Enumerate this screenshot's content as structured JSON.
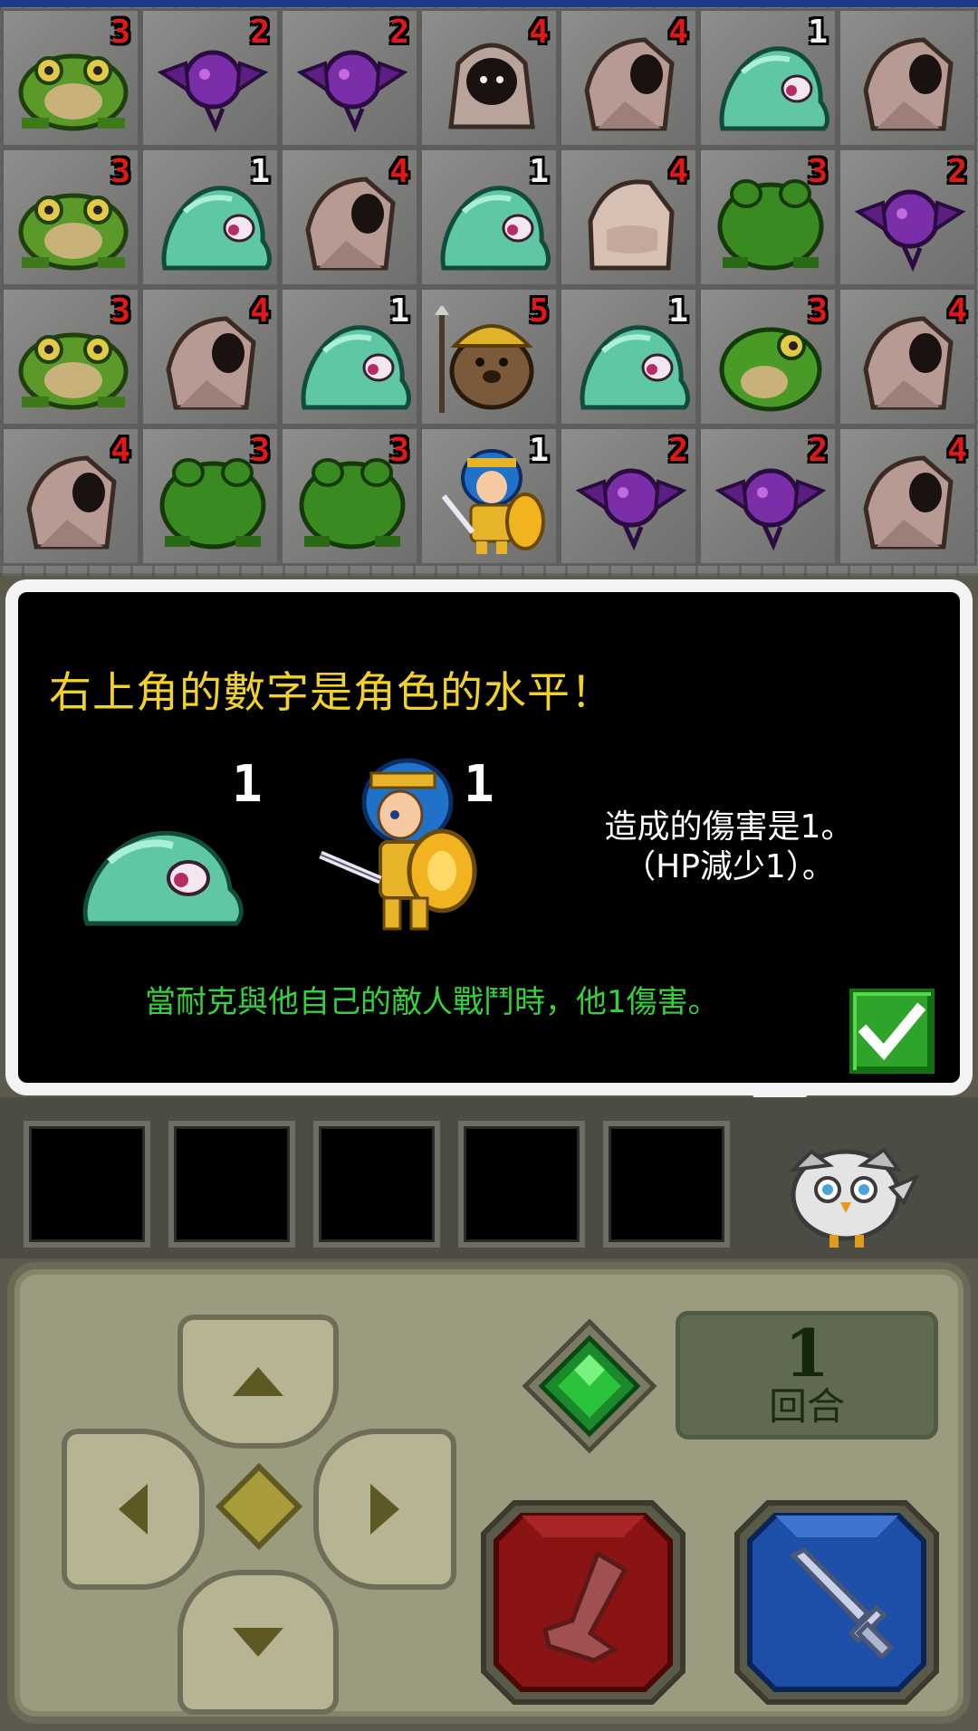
{
  "board": {
    "rows": [
      [
        {
          "unit": "frog",
          "level": "3",
          "kind": "enemy"
        },
        {
          "unit": "bat",
          "level": "2",
          "kind": "enemy"
        },
        {
          "unit": "bat",
          "level": "2",
          "kind": "enemy"
        },
        {
          "unit": "hooded-ghost",
          "level": "4",
          "kind": "enemy"
        },
        {
          "unit": "hood-mage",
          "level": "4",
          "kind": "enemy"
        },
        {
          "unit": "slime",
          "level": "1",
          "kind": "neutral"
        },
        {
          "unit": "hood-mage",
          "level": "",
          "kind": "enemy"
        }
      ],
      [
        {
          "unit": "frog",
          "level": "3",
          "kind": "enemy"
        },
        {
          "unit": "slime",
          "level": "1",
          "kind": "neutral"
        },
        {
          "unit": "hood-mage",
          "level": "4",
          "kind": "enemy"
        },
        {
          "unit": "slime",
          "level": "1",
          "kind": "neutral"
        },
        {
          "unit": "hood-mage-back",
          "level": "4",
          "kind": "enemy"
        },
        {
          "unit": "frog-back",
          "level": "3",
          "kind": "enemy"
        },
        {
          "unit": "bat",
          "level": "2",
          "kind": "enemy"
        }
      ],
      [
        {
          "unit": "frog",
          "level": "3",
          "kind": "enemy"
        },
        {
          "unit": "hood-mage",
          "level": "4",
          "kind": "enemy"
        },
        {
          "unit": "slime",
          "level": "1",
          "kind": "neutral"
        },
        {
          "unit": "mole-soldier",
          "level": "5",
          "kind": "enemy"
        },
        {
          "unit": "slime",
          "level": "1",
          "kind": "neutral"
        },
        {
          "unit": "frog-side",
          "level": "3",
          "kind": "enemy"
        },
        {
          "unit": "hood-mage",
          "level": "4",
          "kind": "enemy"
        }
      ],
      [
        {
          "unit": "hood-mage",
          "level": "4",
          "kind": "enemy"
        },
        {
          "unit": "frog-back",
          "level": "3",
          "kind": "enemy"
        },
        {
          "unit": "frog-back",
          "level": "3",
          "kind": "enemy"
        },
        {
          "unit": "hero",
          "level": "1",
          "kind": "neutral"
        },
        {
          "unit": "bat",
          "level": "2",
          "kind": "enemy"
        },
        {
          "unit": "bat",
          "level": "2",
          "kind": "enemy"
        },
        {
          "unit": "hood-mage",
          "level": "4",
          "kind": "enemy"
        }
      ]
    ]
  },
  "dialog": {
    "title": "右上角的數字是角色的水平！",
    "demo_slime_level": "1",
    "demo_hero_level": "1",
    "damage_text": "造成的傷害是1。\n（HP減少1）。",
    "hint_text": "當耐克與他自己的敵人戰鬥時，他1傷害。",
    "confirm_icon": "check-icon"
  },
  "slots": {
    "count": 5,
    "companion_icon": "owl-icon"
  },
  "controls": {
    "turn_number": "1",
    "turn_label": "回合",
    "icons": {
      "up": "arrow-up-icon",
      "down": "arrow-down-icon",
      "left": "arrow-left-icon",
      "right": "arrow-right-icon",
      "gem": "green-gem-icon",
      "item": "boot-icon",
      "attack": "sword-icon"
    }
  },
  "colors": {
    "enemy_level": "#e01818",
    "neutral_level": "#f2f2f2",
    "dialog_title": "#f2d22a",
    "hint_text": "#34d23a",
    "item_button": "#8a1414",
    "attack_button": "#1e4fa8"
  }
}
